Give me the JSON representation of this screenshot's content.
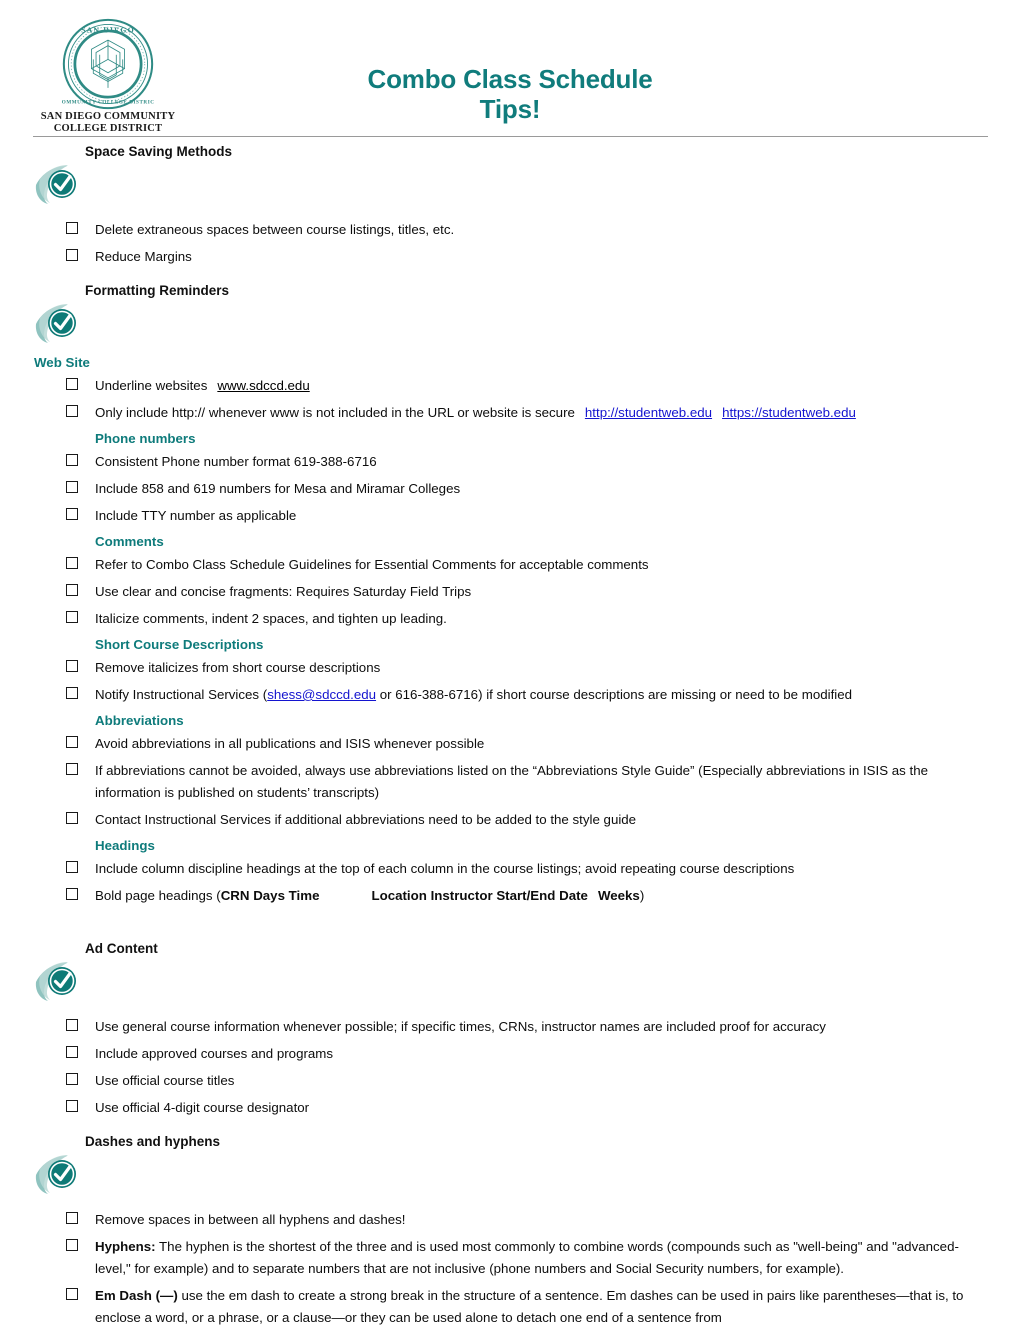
{
  "header": {
    "logo_alt": "San Diego Community College District seal",
    "logo_line1": "SAN DIEGO COMMUNITY",
    "logo_line2": "COLLEGE DISTRICT",
    "seal_top_text": "SAN DIEGO",
    "seal_bottom_text": "COMMUNITY COLLEGE DISTRICT",
    "title_line1": "Combo Class Schedule",
    "title_line2": "Tips!",
    "accent_color": "#107C7C",
    "link_color": "#1414CF"
  },
  "sections": [
    {
      "title": "Space Saving Methods",
      "items": [
        "Delete extraneous spaces between course listings, titles, etc.",
        "Reduce Margins"
      ]
    },
    {
      "title": "Formatting Reminders",
      "groups": [
        {
          "heading": "Web Site",
          "heading_flush": true,
          "items": [
            "Underline websites",
            "Only include http:// whenever www is not included in the URL or website is secure"
          ],
          "item0_link_text": "www.sdccd.edu",
          "item1_link1": "http://studentweb.edu",
          "item1_link2": "https://studentweb.edu"
        },
        {
          "heading": "Phone numbers",
          "items": [
            "Consistent Phone number format   619-388-6716",
            "Include 858 and 619 numbers for Mesa and Miramar Colleges",
            "Include TTY number as applicable"
          ]
        },
        {
          "heading": "Comments",
          "items": [
            "Refer to Combo Class Schedule Guidelines for Essential Comments for acceptable comments",
            "Use clear and concise fragments:  Requires Saturday Field Trips",
            "Italicize comments, indent 2 spaces, and tighten up leading."
          ]
        },
        {
          "heading": "Short Course Descriptions",
          "items": [
            "Remove italicizes from short course descriptions"
          ],
          "notify_prefix": "Notify Instructional Services (",
          "notify_email": "shess@sdccd.edu",
          "notify_suffix": " or 616-388-6716) if short course descriptions are missing or need to be modified"
        },
        {
          "heading": "Abbreviations",
          "items": [
            "Avoid abbreviations in all publications and ISIS whenever possible",
            "If abbreviations cannot be avoided, always use abbreviations listed on the “Abbreviations Style Guide”  (Especially abbreviations in ISIS as the information is published on students’ transcripts)",
            "Contact Instructional Services if additional abbreviations need to be added to the style guide"
          ]
        },
        {
          "heading": "Headings",
          "items": [
            "Include column discipline headings at the top of each column in the course listings; avoid repeating course descriptions"
          ],
          "bold_headings_prefix": "Bold page headings (",
          "bold_headings_cols1": "CRN   Days   Time",
          "bold_headings_cols2": "Location Instructor Start/End Date",
          "bold_headings_cols3": "Weeks",
          "bold_headings_suffix": ")"
        }
      ]
    },
    {
      "title": "Ad Content",
      "items": [
        "Use general course information whenever possible; if specific times, CRNs, instructor names are included proof for accuracy",
        "Include approved courses and programs",
        "Use official course titles",
        "Use official 4-digit course designator"
      ]
    },
    {
      "title": "Dashes and hyphens",
      "items": [
        "Remove spaces in between all hyphens and dashes!"
      ],
      "hyphens_label": "Hyphens:",
      "hyphens_text": " The hyphen is the shortest of the three and is used most commonly to combine words (compounds such as \"well-being\" and \"advanced-level,\" for example) and to separate numbers that are not inclusive (phone numbers and Social Security numbers, for example).",
      "emdash_label": "Em Dash (—)",
      "emdash_text": " use the em dash to create a strong break in the structure of a sentence. Em dashes can be used in pairs like parentheses—that is, to enclose a word, or a phrase, or a clause—or they can be used alone to detach one end of a sentence from"
    }
  ],
  "icons": {
    "check_badge": "check-circle-swoosh-icon",
    "checkbox": "empty-checkbox-icon"
  }
}
